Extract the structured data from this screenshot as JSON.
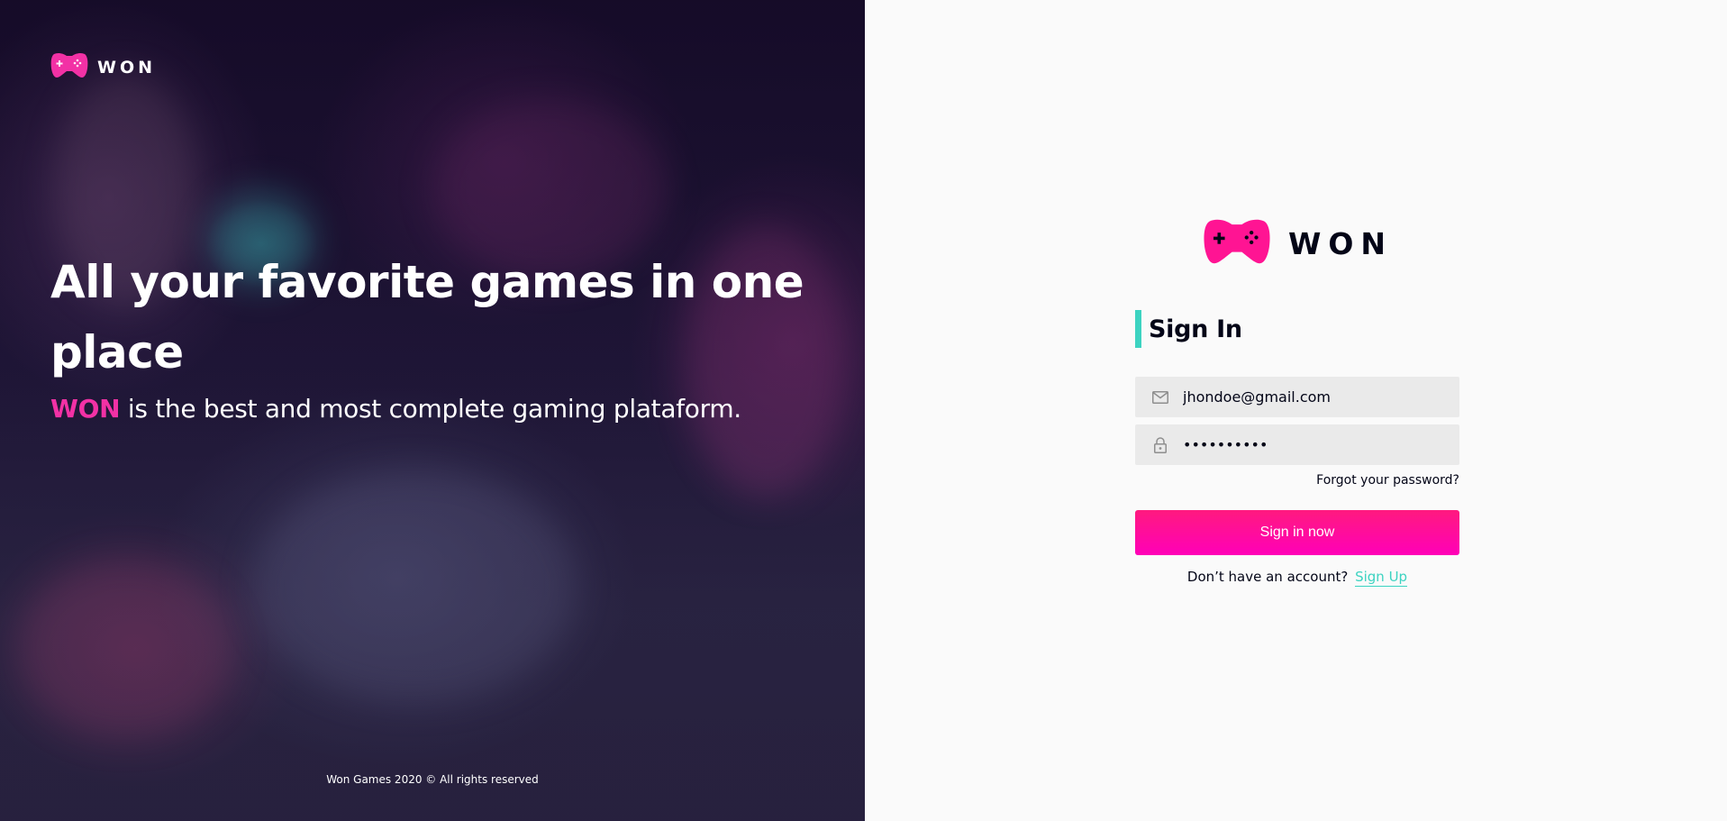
{
  "colors": {
    "brand_pink": "#f231a5",
    "accent_teal": "#3cd3c1",
    "button_pink": "#ff00b8",
    "dark_text": "#030517",
    "field_bg": "#eaeaea",
    "panel_bg": "#fafafa"
  },
  "banner": {
    "logo": {
      "icon": "gamepad-icon",
      "wordmark": "WON"
    },
    "title": "All your favorite games in one place",
    "subtitle_brand": "WON",
    "subtitle_rest": " is the best and most complete gaming plataform.",
    "footer": "Won Games 2020 © All rights reserved"
  },
  "signin": {
    "logo": {
      "icon": "gamepad-icon",
      "wordmark": "WON"
    },
    "heading": "Sign In",
    "email": {
      "icon": "email-icon",
      "value": "jhondoe@gmail.com"
    },
    "password": {
      "icon": "lock-icon",
      "value": "••••••••••"
    },
    "forgot_label": "Forgot your password?",
    "submit_label": "Sign in now",
    "signup_prompt": "Don’t have an account?",
    "signup_link": "Sign Up"
  }
}
